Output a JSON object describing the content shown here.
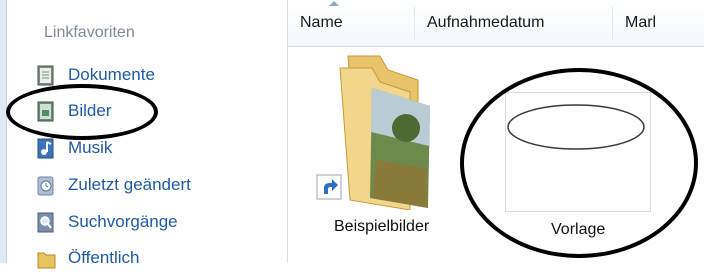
{
  "nav": {
    "section_title": "Linkfavoriten",
    "items": [
      {
        "label": "Dokumente",
        "icon": "documents-icon"
      },
      {
        "label": "Bilder",
        "icon": "pictures-icon"
      },
      {
        "label": "Musik",
        "icon": "music-icon"
      },
      {
        "label": "Zuletzt geändert",
        "icon": "recent-icon"
      },
      {
        "label": "Suchvorgänge",
        "icon": "searches-icon"
      },
      {
        "label": "Öffentlich",
        "icon": "public-folder-icon"
      }
    ]
  },
  "columns": [
    "Name",
    "Aufnahmedatum",
    "Marl"
  ],
  "files": [
    {
      "name": "Beispielbilder",
      "type": "folder-shortcut"
    },
    {
      "name": "Vorlage",
      "type": "image-thumbnail"
    }
  ],
  "colors": {
    "link": "#1e5aa8",
    "section_title": "#7f8a96",
    "annotation": "#000000"
  }
}
